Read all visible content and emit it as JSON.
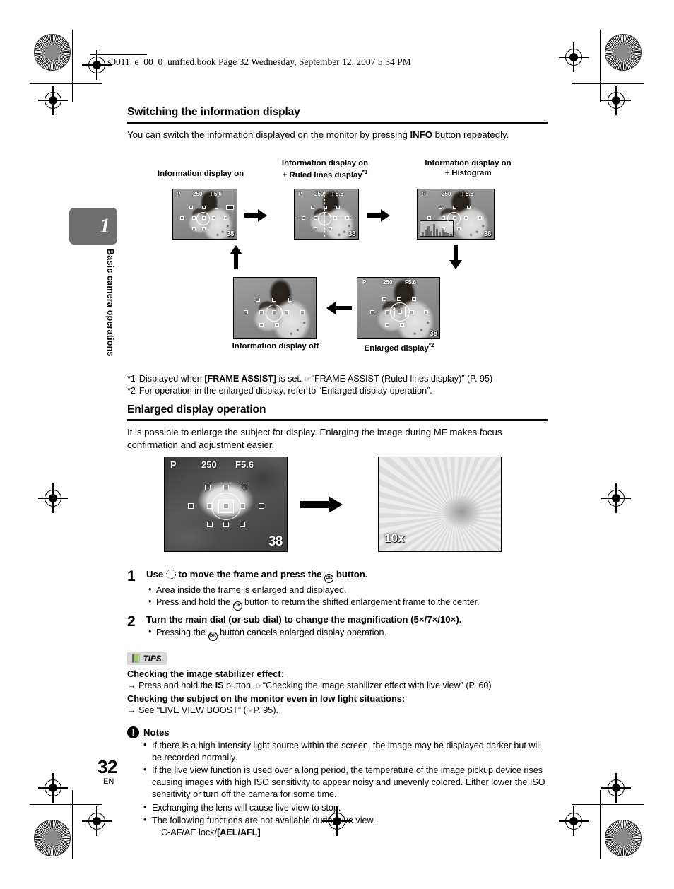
{
  "header": {
    "book_line": "s0011_e_00_0_unified.book  Page 32  Wednesday, September 12, 2007  5:34 PM"
  },
  "sidebar": {
    "chapter_number": "1",
    "chapter_title": "Basic camera operations",
    "page_number": "32",
    "page_language": "EN"
  },
  "section_1": {
    "heading": "Switching the information display",
    "intro_before": "You can switch the information displayed on the monitor by pressing ",
    "intro_bold": "INFO",
    "intro_after": " button repeatedly."
  },
  "flow": {
    "labels": {
      "info_on": "Information display on",
      "ruled_line1": "Information display on",
      "ruled_line2": "+ Ruled lines display",
      "ruled_sup": "*1",
      "histogram_line1": "Information display on",
      "histogram_line2": "+ Histogram",
      "info_off": "Information display off",
      "enlarged": "Enlarged display",
      "enlarged_sup": "*2"
    },
    "lcd": {
      "mode": "P",
      "shutter": "250",
      "aperture": "F5.6",
      "frames": "38",
      "battery": "■■"
    }
  },
  "footnotes": [
    {
      "mark": "*1",
      "parts": [
        {
          "t": "Displayed when ",
          "b": false
        },
        {
          "t": "[FRAME ASSIST]",
          "b": true
        },
        {
          "t": " is set. ",
          "b": false
        },
        {
          "t": "☞",
          "b": false,
          "ref": true
        },
        {
          "t": "“FRAME ASSIST (Ruled lines display)” (P. 95)",
          "b": false
        }
      ]
    },
    {
      "mark": "*2",
      "parts": [
        {
          "t": "For operation in the enlarged display, refer to “Enlarged display operation”.",
          "b": false
        }
      ]
    }
  ],
  "section_2": {
    "heading": "Enlarged display operation",
    "intro": "It is possible to enlarge the subject for display. Enlarging the image during MF makes focus confirmation and adjustment easier."
  },
  "demo": {
    "left_lcd": {
      "mode": "P",
      "shutter": "250",
      "aperture": "F5.6",
      "frames": "38"
    },
    "right_lcd": {
      "zoom": "10x"
    }
  },
  "steps": [
    {
      "number": "1",
      "title_before": "Use ",
      "title_icon_1": "arrow-pad-icon",
      "title_middle": " to move the frame and press the ",
      "title_icon_2": "ok-button-icon",
      "title_after": " button.",
      "bullets": [
        {
          "before": "Area inside the frame is enlarged and displayed.",
          "icon": null,
          "after": ""
        },
        {
          "before": "Press and hold the ",
          "icon": "ok-button-icon",
          "after": " button to return the shifted enlargement frame to the center."
        }
      ]
    },
    {
      "number": "2",
      "title_before": "Turn the main dial (or sub dial) to change the magnification (5×/7×/10×).",
      "title_icon_1": null,
      "title_middle": "",
      "title_icon_2": null,
      "title_after": "",
      "bullets": [
        {
          "before": "Pressing the ",
          "icon": "ok-button-icon",
          "after": " button cancels enlarged display operation."
        }
      ]
    }
  ],
  "tips": {
    "badge": "TIPS",
    "items": [
      {
        "heading": "Checking the image stabilizer effect:",
        "arrow": "→",
        "text_before": " Press and hold the ",
        "bold_token": "IS",
        "text_mid": " button. ",
        "ref": "☞",
        "text_after": "“Checking the image stabilizer effect with live view” (P. 60)"
      },
      {
        "heading": "Checking the subject on the monitor even in low light situations:",
        "arrow": "→",
        "text_before": " See “LIVE VIEW BOOST” (",
        "bold_token": "",
        "text_mid": "",
        "ref": "☞",
        "text_after": "P. 95)."
      }
    ]
  },
  "notes": {
    "title": "Notes",
    "icon": "exclamation-icon",
    "items": [
      "If there is a high-intensity light source within the screen, the image may be displayed darker but will be recorded normally.",
      "If the live view function is used over a long period, the temperature of the image pickup device rises causing images with high ISO sensitivity to appear noisy and unevenly colored. Either lower the ISO sensitivity or turn off the camera for some time.",
      "Exchanging the lens will cause live view to stop.",
      "The following functions are not available during live view."
    ],
    "last_sub_plain": "C-AF/AE lock/",
    "last_sub_bold": "[AEL/AFL]"
  },
  "colors": {
    "chapter_tab_bg": "#6e6e6e",
    "tips_badge_bg": "#d8d8d8",
    "rule": "#000000"
  }
}
